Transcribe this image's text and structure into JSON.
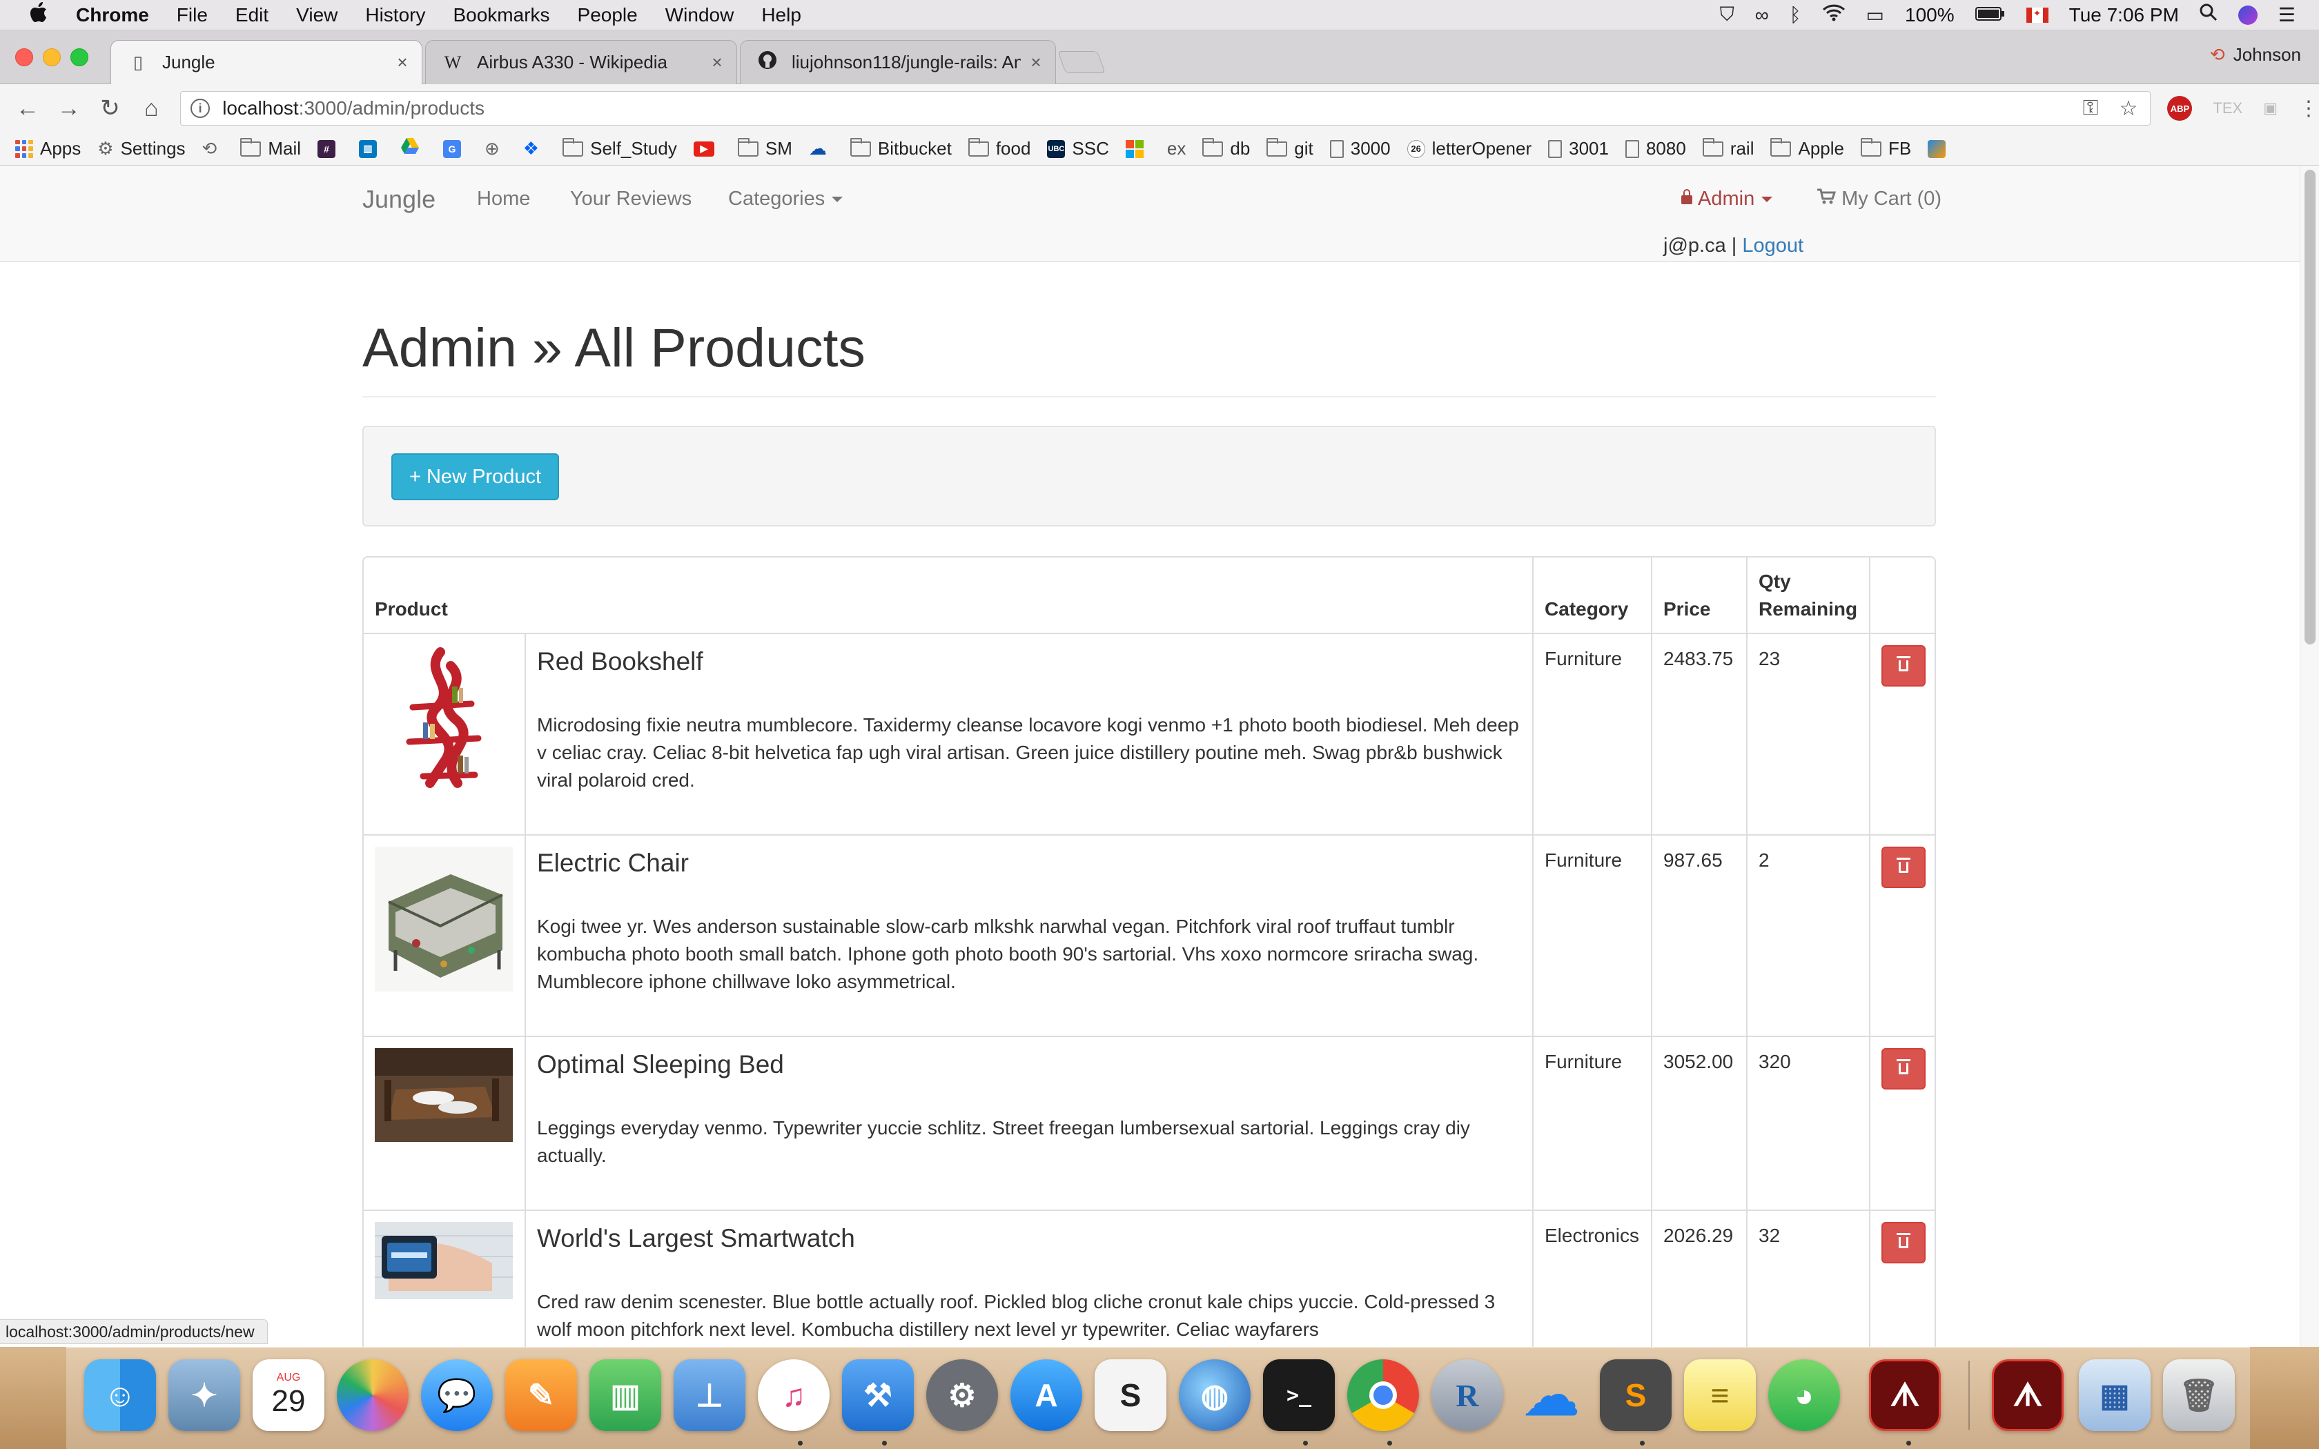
{
  "colors": {
    "brand_info": "#31b0d5",
    "danger": "#d9534f",
    "admin_red": "#a94442",
    "link_blue": "#337ab7"
  },
  "menubar": {
    "app": "Chrome",
    "items": [
      "File",
      "Edit",
      "View",
      "History",
      "Bookmarks",
      "People",
      "Window",
      "Help"
    ],
    "battery": "100%",
    "clock": "Tue 7:06 PM"
  },
  "tabs": [
    {
      "title": "Jungle",
      "icon": "page-icon",
      "active": true
    },
    {
      "title": "Airbus A330 - Wikipedia",
      "icon": "wikipedia-icon",
      "active": false
    },
    {
      "title": "liujohnson118/jungle-rails: An",
      "icon": "github-icon",
      "active": false
    }
  ],
  "profile_name": "Johnson",
  "address": {
    "host": "localhost",
    "path": ":3000/admin/products"
  },
  "bookmarks": [
    {
      "label": "Apps",
      "icon": "apps-icon"
    },
    {
      "label": "Settings",
      "icon": "gear-icon"
    },
    {
      "label": "",
      "icon": "history-icon"
    },
    {
      "label": "Mail",
      "icon": "folder-icon"
    },
    {
      "label": "",
      "icon": "slack-icon"
    },
    {
      "label": "",
      "icon": "trello-icon"
    },
    {
      "label": "",
      "icon": "drive-icon"
    },
    {
      "label": "",
      "icon": "translate-icon"
    },
    {
      "label": "",
      "icon": "circle-plus-icon"
    },
    {
      "label": "",
      "icon": "dropbox-icon"
    },
    {
      "label": "Self_Study",
      "icon": "folder-icon"
    },
    {
      "label": "",
      "icon": "youtube-icon"
    },
    {
      "label": "SM",
      "icon": "folder-icon"
    },
    {
      "label": "",
      "icon": "cloud-icon"
    },
    {
      "label": "Bitbucket",
      "icon": "folder-icon"
    },
    {
      "label": "food",
      "icon": "folder-icon"
    },
    {
      "label": "SSC",
      "icon": "ubc-icon"
    },
    {
      "label": "",
      "icon": "microsoft-icon"
    },
    {
      "label": "ex",
      "icon": ""
    },
    {
      "label": "db",
      "icon": "folder-icon"
    },
    {
      "label": "git",
      "icon": "folder-icon"
    },
    {
      "label": "3000",
      "icon": "doc-icon"
    },
    {
      "label": "letterOpener",
      "icon": "badge-26-icon"
    },
    {
      "label": "3001",
      "icon": "doc-icon"
    },
    {
      "label": "8080",
      "icon": "doc-icon"
    },
    {
      "label": "rail",
      "icon": "folder-icon"
    },
    {
      "label": "Apple",
      "icon": "folder-icon"
    },
    {
      "label": "FB",
      "icon": "folder-icon"
    },
    {
      "label": "",
      "icon": "app-square-icon"
    }
  ],
  "site_nav": {
    "brand": "Jungle",
    "links": [
      "Home",
      "Your Reviews",
      "Categories"
    ],
    "admin": "Admin",
    "cart": "My Cart (0)",
    "user_email": "j@p.ca",
    "separator": "|",
    "logout": "Logout"
  },
  "page": {
    "title": "Admin » All Products",
    "new_product_button": "+ New Product"
  },
  "table": {
    "headers": {
      "product": "Product",
      "category": "Category",
      "price": "Price",
      "qty": "Qty Remaining"
    },
    "rows": [
      {
        "name": "Red Bookshelf",
        "description": "Microdosing fixie neutra mumblecore. Taxidermy cleanse locavore kogi venmo +1 photo booth biodiesel. Meh deep v celiac cray. Celiac 8-bit helvetica fap ugh viral artisan. Green juice distillery poutine meh. Swag pbr&b bushwick viral polaroid cred.",
        "category": "Furniture",
        "price": "2483.75",
        "qty": "23"
      },
      {
        "name": "Electric Chair",
        "description": "Kogi twee yr. Wes anderson sustainable slow-carb mlkshk narwhal vegan. Pitchfork viral roof truffaut tumblr kombucha photo booth small batch. Iphone goth photo booth 90's sartorial. Vhs xoxo normcore sriracha swag. Mumblecore iphone chillwave loko asymmetrical.",
        "category": "Furniture",
        "price": "987.65",
        "qty": "2"
      },
      {
        "name": "Optimal Sleeping Bed",
        "description": "Leggings everyday venmo. Typewriter yuccie schlitz. Street freegan lumbersexual sartorial. Leggings cray diy actually.",
        "category": "Furniture",
        "price": "3052.00",
        "qty": "320"
      },
      {
        "name": "World's Largest Smartwatch",
        "description": "Cred raw denim scenester. Blue bottle actually roof. Pickled blog cliche cronut kale chips yuccie. Cold-pressed 3 wolf moon pitchfork next level. Kombucha distillery next level yr typewriter. Celiac wayfarers",
        "category": "Electronics",
        "price": "2026.29",
        "qty": "32"
      }
    ]
  },
  "status_url": "localhost:3000/admin/products/new",
  "dock": {
    "calendar_month": "AUG",
    "calendar_day": "29",
    "items": [
      "finder-icon",
      "preview-icon",
      "calendar-icon",
      "photos-icon",
      "messages-icon",
      "pages-icon",
      "numbers-icon",
      "keynote-icon",
      "itunes-icon",
      "xcode-icon",
      "system-preferences-icon",
      "app-store-icon",
      "slack-icon",
      "network-icon",
      "terminal-icon",
      "chrome-icon",
      "r-icon",
      "onedrive-icon",
      "sublime-icon",
      "notes-icon",
      "wechat-icon",
      "acrobat-icon",
      "acrobat-icon-2",
      "downloads-stack-icon",
      "trash-icon"
    ]
  }
}
